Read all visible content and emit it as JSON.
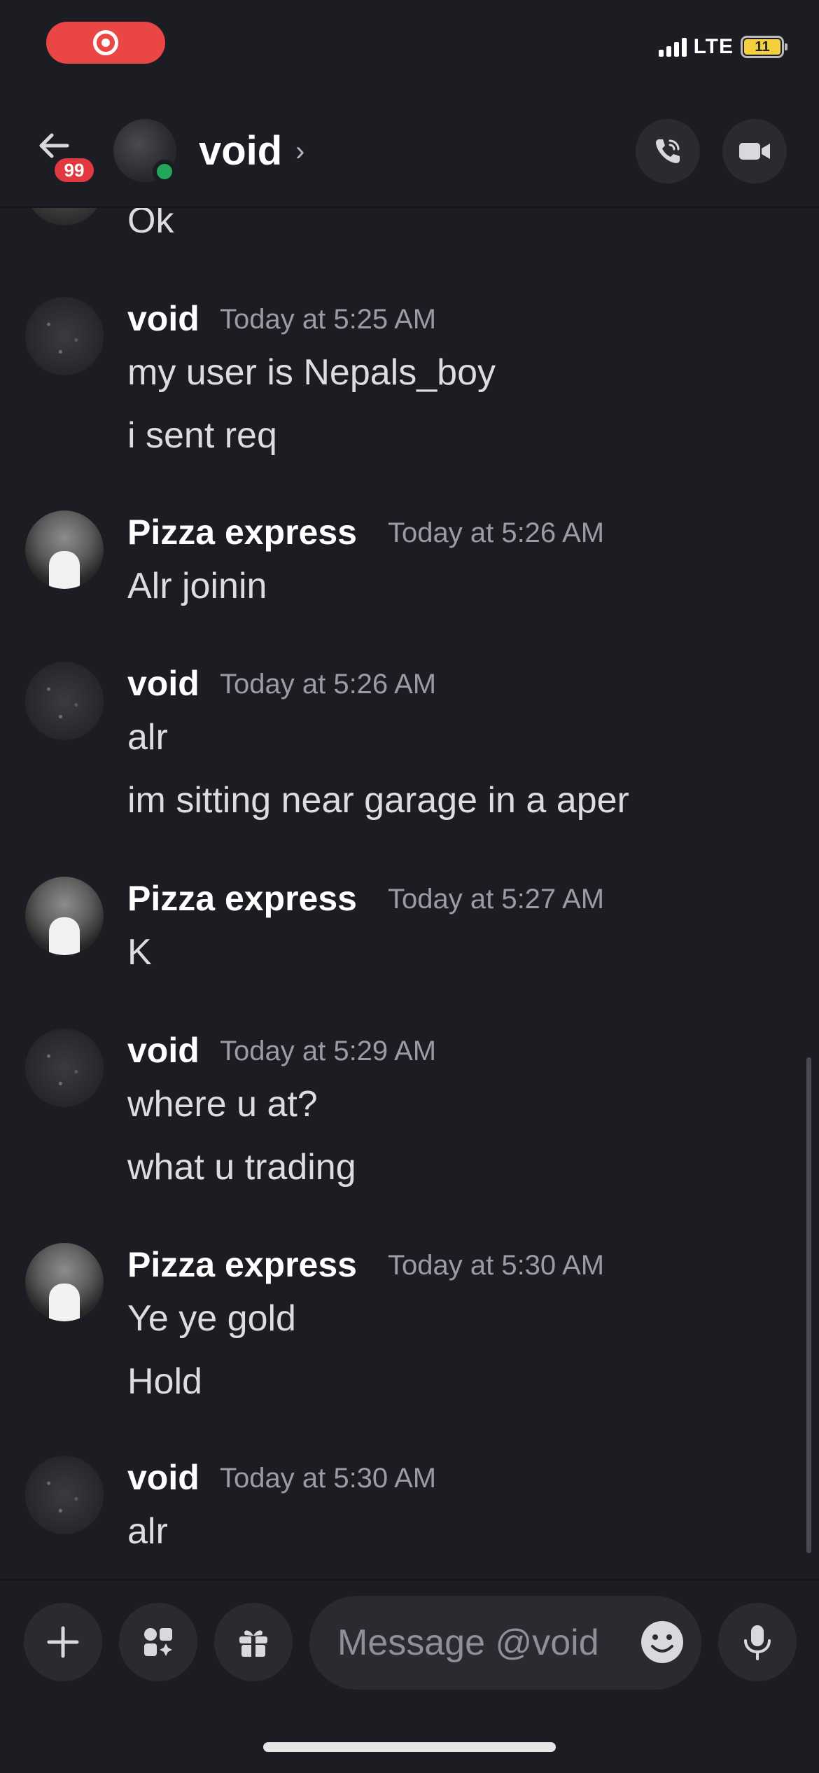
{
  "status_bar": {
    "network": "LTE",
    "battery": "11"
  },
  "header": {
    "unread_count": "99",
    "name": "void",
    "chevron": "›"
  },
  "messages": {
    "partial": {
      "text": "Ok"
    },
    "groups": [
      {
        "author": "void",
        "time": "Today at 5:25 AM",
        "lines": [
          "my user is Nepals_boy",
          "i  sent req"
        ]
      },
      {
        "author": "Pizza express",
        "time": "Today at 5:26 AM",
        "lines": [
          "Alr joinin"
        ]
      },
      {
        "author": "void",
        "time": "Today at 5:26 AM",
        "lines": [
          "alr",
          "im sitting near garage in a aper"
        ]
      },
      {
        "author": "Pizza express",
        "time": "Today at 5:27 AM",
        "lines": [
          "K"
        ]
      },
      {
        "author": "void",
        "time": "Today at 5:29 AM",
        "lines": [
          "where u at?",
          "what u trading"
        ]
      },
      {
        "author": "Pizza express",
        "time": "Today at 5:30 AM",
        "lines": [
          "Ye ye gold",
          "Hold"
        ]
      },
      {
        "author": "void",
        "time": "Today at 5:30 AM",
        "lines": [
          "alr"
        ]
      }
    ]
  },
  "composer": {
    "placeholder": "Message @void"
  },
  "colors": {
    "background": "#1c1d23",
    "online": "#23a55a",
    "badge": "#e2383f",
    "record": "#eb4646"
  },
  "icons": {
    "back": "arrow-left-icon",
    "call": "phone-icon",
    "video": "video-camera-icon",
    "plus": "plus-icon",
    "apps": "apps-icon",
    "gift": "gift-icon",
    "emoji": "emoji-icon",
    "mic": "microphone-icon"
  }
}
